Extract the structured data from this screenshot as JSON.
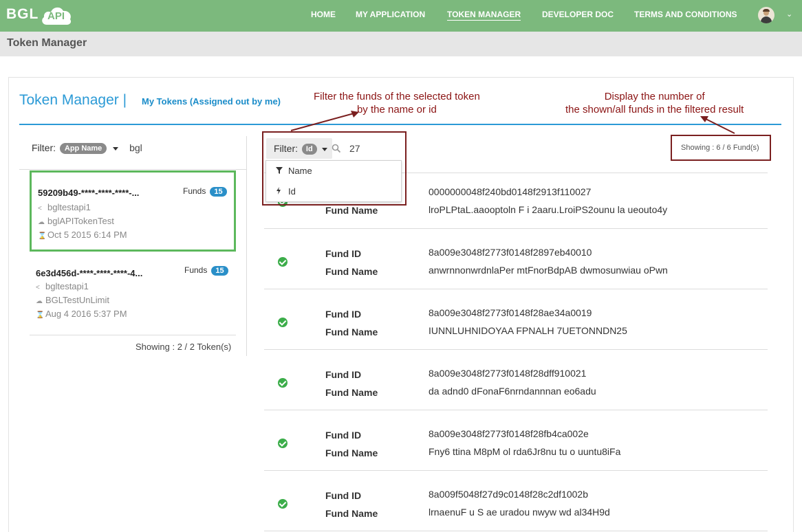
{
  "brand": {
    "logo_text": "BGL",
    "logo_badge": "API"
  },
  "nav": {
    "items": [
      "HOME",
      "MY APPLICATION",
      "TOKEN MANAGER",
      "DEVELOPER DOC",
      "TERMS AND CONDITIONS"
    ],
    "active": "TOKEN MANAGER"
  },
  "page_title": "Token Manager",
  "header": {
    "title": "Token Manager |",
    "subtitle": "My Tokens (Assigned out by me)"
  },
  "annotations": {
    "filter": [
      "Filter the funds of the selected token",
      "by the name or id"
    ],
    "display": [
      "Display the number of",
      "the shown/all funds in the filtered result"
    ]
  },
  "left": {
    "filter_label": "Filter:",
    "filter_type": "App Name",
    "filter_value": "bgl",
    "tokens": [
      {
        "id": "59209b49-****-****-****-...",
        "funds_label": "Funds",
        "funds_count": "15",
        "app": "bgltestapi1",
        "name": "bglAPITokenTest",
        "date": "Oct 5 2015 6:14 PM"
      },
      {
        "id": "6e3d456d-****-****-****-4...",
        "funds_label": "Funds",
        "funds_count": "15",
        "app": "bgltestapi1",
        "name": "BGLTestUnLimit",
        "date": "Aug 4 2016 5:37 PM"
      }
    ],
    "showing": "Showing : 2 / 2 Token(s)"
  },
  "right": {
    "filter_label": "Filter:",
    "filter_type": "Id",
    "search_value": "27",
    "dropdown": [
      "Name",
      "Id"
    ],
    "showing": "Showing : 6  /  6 Fund(s)",
    "fund_id_label": "Fund ID",
    "fund_name_label": "Fund Name",
    "funds": [
      {
        "id": "0000000048f240bd0148f2913f110027",
        "name": "lroPLPtaL.aaooptoln F i 2aaru.LroiPS2ounu la ueouto4y"
      },
      {
        "id": "8a009e3048f2773f0148f2897eb40010",
        "name": "anwrnnonwrdnlaPer mtFnorBdpAB dwmosunwiau oPwn"
      },
      {
        "id": "8a009e3048f2773f0148f28ae34a0019",
        "name": "IUNNLUHNIDOYAA FPNALH 7UETONNDN25"
      },
      {
        "id": "8a009e3048f2773f0148f28dff910021",
        "name": "da adnd0 dFonaF6nrndannnan eo6adu"
      },
      {
        "id": "8a009e3048f2773f0148f28fb4ca002e",
        "name": "Fny6 ttina M8pM ol rda6Jr8nu tu o uuntu8iFa"
      },
      {
        "id": "8a009f5048f27d9c0148f28c2df1002b",
        "name": "lrnaenuF u S ae uradou nwyw wd al34H9d"
      }
    ]
  }
}
